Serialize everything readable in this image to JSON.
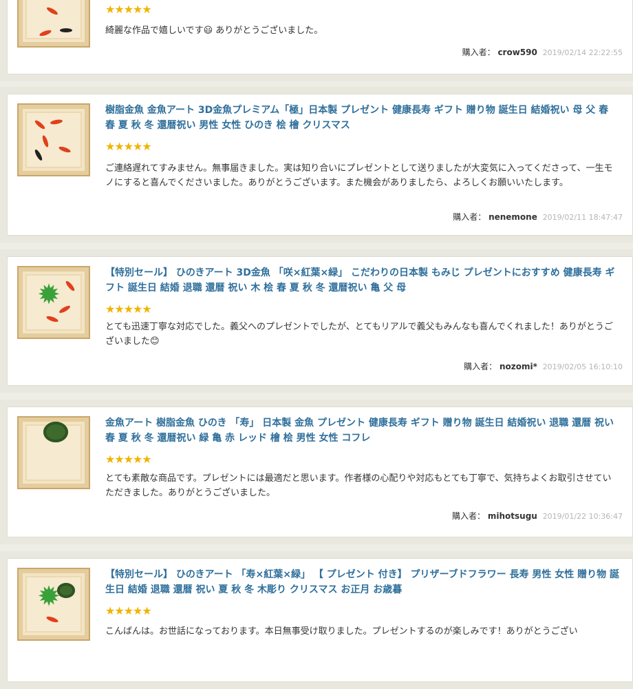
{
  "reviews": [
    {
      "title": "",
      "stars": "★★★★★",
      "body": "綺麗な作品で嬉しいです😃 ありがとうございました。",
      "buyer_label": "購入者：",
      "buyer_name": "crow590",
      "date": "2019/02/14 22:22:55"
    },
    {
      "title": "樹脂金魚 金魚アート 3D金魚プレミアム「極」日本製 プレゼント 健康長寿 ギフト 贈り物 誕生日 結婚祝い 母 父 春 春 夏 秋 冬 還暦祝い 男性 女性 ひのき 桧 檜 クリスマス",
      "stars": "★★★★★",
      "body": "ご連絡遅れてすみません。無事届きました。実は知り合いにプレゼントとして送りましたが大変気に入ってくださって、一生モノにすると喜んでくださいました。ありがとうございます。また機会がありましたら、よろしくお願いいたします。",
      "buyer_label": "購入者：",
      "buyer_name": "nenemone",
      "date": "2019/02/11 18:47:47"
    },
    {
      "title": "【特別セール】 ひのきアート 3D金魚 「咲×紅葉×緑」 こだわりの日本製 もみじ プレゼントにおすすめ 健康長寿 ギフト 誕生日 結婚 退職 還暦 祝い 木 桧 春 夏 秋 冬 還暦祝い 亀 父 母",
      "stars": "★★★★★",
      "body": "とても迅速丁寧な対応でした。義父へのプレゼントでしたが、とてもリアルで義父もみんなも喜んでくれました！ありがとうございました😊",
      "buyer_label": "購入者：",
      "buyer_name": "nozomi*",
      "date": "2019/02/05 16:10:10"
    },
    {
      "title": "金魚アート 樹脂金魚 ひのき 「寿」 日本製 金魚 プレゼント 健康長寿 ギフト 贈り物 誕生日 結婚祝い 退職 還暦 祝い 春 夏 秋 冬 還暦祝い 緑 亀 赤 レッド 檜 桧 男性 女性 コフレ",
      "stars": "★★★★★",
      "body": "とても素敵な商品です。プレゼントには最適だと思います。作者様の心配りや対応もとても丁寧で、気持ちよくお取引させていただきました。ありがとうございました。",
      "buyer_label": "購入者：",
      "buyer_name": "mihotsugu",
      "date": "2019/01/22 10:36:47"
    },
    {
      "title": "【特別セール】 ひのきアート 「寿×紅葉×緑」 【 プレゼント 付き】 プリザーブドフラワー 長寿 男性 女性 贈り物 誕生日 結婚 退職 還暦 祝い 夏 秋 冬 木彫り クリスマス お正月 お歳暮",
      "stars": "★★★★★",
      "body": "こんばんは。お世話になっております。本日無事受け取りました。プレゼントするのが楽しみです！ありがとうござい",
      "buyer_label": "",
      "buyer_name": "",
      "date": ""
    }
  ]
}
